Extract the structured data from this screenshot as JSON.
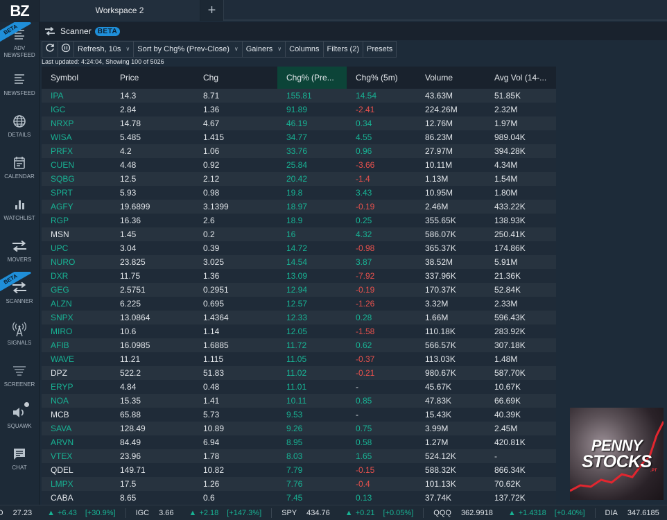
{
  "app": {
    "logo": "BZ",
    "tabs": [
      {
        "label": "Workspace 2"
      }
    ],
    "add_tab_label": "+"
  },
  "sidebar": {
    "items": [
      {
        "id": "adv-newsfeed",
        "label": "ADV NEWSFEED",
        "icon": "lines-icon",
        "beta": true
      },
      {
        "id": "newsfeed",
        "label": "NEWSFEED",
        "icon": "newsfeed-icon"
      },
      {
        "id": "details",
        "label": "DETAILS",
        "icon": "globe-icon"
      },
      {
        "id": "calendar",
        "label": "CALENDAR",
        "icon": "calendar-icon"
      },
      {
        "id": "watchlist",
        "label": "WATCHLIST",
        "icon": "bar-chart-icon"
      },
      {
        "id": "movers",
        "label": "MOVERS",
        "icon": "swap-icon"
      },
      {
        "id": "scanner",
        "label": "SCANNER",
        "icon": "swap-icon",
        "beta": true
      },
      {
        "id": "signals",
        "label": "SIGNALS",
        "icon": "antenna-icon"
      },
      {
        "id": "screener",
        "label": "SCREENER",
        "icon": "filter-icon"
      },
      {
        "id": "squawk",
        "label": "SQUAWK",
        "icon": "speaker-icon"
      },
      {
        "id": "chat",
        "label": "CHAT",
        "icon": "chat-icon"
      }
    ],
    "beta_label": "BETA"
  },
  "scanner": {
    "title": "Scanner",
    "badge": "BETA",
    "toolbar": {
      "refresh": "Refresh, 10s",
      "sort": "Sort by Chg% (Prev-Close)",
      "gainers": "Gainers",
      "columns": "Columns",
      "filters": "Filters (2)",
      "presets": "Presets"
    },
    "status": "Last updated: 4:24:04, Showing 100 of 5026",
    "columns": [
      "Symbol",
      "Price",
      "Chg",
      "Chg% (Pre...",
      "Chg% (5m)",
      "Volume",
      "Avg Vol (14-..."
    ],
    "sorted_column": 3,
    "rows": [
      {
        "symbol": "IPA",
        "price": "14.3",
        "chg": "8.71",
        "chgpct": "155.81",
        "chg5m": "14.54",
        "volume": "43.63M",
        "avgvol": "51.85K",
        "sym_color": "green",
        "dir5m": "pos"
      },
      {
        "symbol": "IGC",
        "price": "2.84",
        "chg": "1.36",
        "chgpct": "91.89",
        "chg5m": "-2.41",
        "volume": "224.26M",
        "avgvol": "2.32M",
        "sym_color": "green",
        "dir5m": "neg"
      },
      {
        "symbol": "NRXP",
        "price": "14.78",
        "chg": "4.67",
        "chgpct": "46.19",
        "chg5m": "0.34",
        "volume": "12.76M",
        "avgvol": "1.97M",
        "sym_color": "green",
        "dir5m": "pos"
      },
      {
        "symbol": "WISA",
        "price": "5.485",
        "chg": "1.415",
        "chgpct": "34.77",
        "chg5m": "4.55",
        "volume": "86.23M",
        "avgvol": "989.04K",
        "sym_color": "green",
        "dir5m": "pos"
      },
      {
        "symbol": "PRFX",
        "price": "4.2",
        "chg": "1.06",
        "chgpct": "33.76",
        "chg5m": "0.96",
        "volume": "27.97M",
        "avgvol": "394.28K",
        "sym_color": "green",
        "dir5m": "pos"
      },
      {
        "symbol": "CUEN",
        "price": "4.48",
        "chg": "0.92",
        "chgpct": "25.84",
        "chg5m": "-3.66",
        "volume": "10.11M",
        "avgvol": "4.34M",
        "sym_color": "green",
        "dir5m": "neg"
      },
      {
        "symbol": "SQBG",
        "price": "12.5",
        "chg": "2.12",
        "chgpct": "20.42",
        "chg5m": "-1.4",
        "volume": "1.13M",
        "avgvol": "1.54M",
        "sym_color": "green",
        "dir5m": "neg"
      },
      {
        "symbol": "SPRT",
        "price": "5.93",
        "chg": "0.98",
        "chgpct": "19.8",
        "chg5m": "3.43",
        "volume": "10.95M",
        "avgvol": "1.80M",
        "sym_color": "green",
        "dir5m": "pos"
      },
      {
        "symbol": "AGFY",
        "price": "19.6899",
        "chg": "3.1399",
        "chgpct": "18.97",
        "chg5m": "-0.19",
        "volume": "2.46M",
        "avgvol": "433.22K",
        "sym_color": "green",
        "dir5m": "neg"
      },
      {
        "symbol": "RGP",
        "price": "16.36",
        "chg": "2.6",
        "chgpct": "18.9",
        "chg5m": "0.25",
        "volume": "355.65K",
        "avgvol": "138.93K",
        "sym_color": "green",
        "dir5m": "pos"
      },
      {
        "symbol": "MSN",
        "price": "1.45",
        "chg": "0.2",
        "chgpct": "16",
        "chg5m": "4.32",
        "volume": "586.07K",
        "avgvol": "250.41K",
        "sym_color": "white",
        "dir5m": "pos"
      },
      {
        "symbol": "UPC",
        "price": "3.04",
        "chg": "0.39",
        "chgpct": "14.72",
        "chg5m": "-0.98",
        "volume": "365.37K",
        "avgvol": "174.86K",
        "sym_color": "green",
        "dir5m": "neg"
      },
      {
        "symbol": "NURO",
        "price": "23.825",
        "chg": "3.025",
        "chgpct": "14.54",
        "chg5m": "3.87",
        "volume": "38.52M",
        "avgvol": "5.91M",
        "sym_color": "green",
        "dir5m": "pos"
      },
      {
        "symbol": "DXR",
        "price": "11.75",
        "chg": "1.36",
        "chgpct": "13.09",
        "chg5m": "-7.92",
        "volume": "337.96K",
        "avgvol": "21.36K",
        "sym_color": "green",
        "dir5m": "neg"
      },
      {
        "symbol": "GEG",
        "price": "2.5751",
        "chg": "0.2951",
        "chgpct": "12.94",
        "chg5m": "-0.19",
        "volume": "170.37K",
        "avgvol": "52.84K",
        "sym_color": "green",
        "dir5m": "neg"
      },
      {
        "symbol": "ALZN",
        "price": "6.225",
        "chg": "0.695",
        "chgpct": "12.57",
        "chg5m": "-1.26",
        "volume": "3.32M",
        "avgvol": "2.33M",
        "sym_color": "green",
        "dir5m": "neg"
      },
      {
        "symbol": "SNPX",
        "price": "13.0864",
        "chg": "1.4364",
        "chgpct": "12.33",
        "chg5m": "0.28",
        "volume": "1.66M",
        "avgvol": "596.43K",
        "sym_color": "green",
        "dir5m": "pos"
      },
      {
        "symbol": "MIRO",
        "price": "10.6",
        "chg": "1.14",
        "chgpct": "12.05",
        "chg5m": "-1.58",
        "volume": "110.18K",
        "avgvol": "283.92K",
        "sym_color": "green",
        "dir5m": "neg"
      },
      {
        "symbol": "AFIB",
        "price": "16.0985",
        "chg": "1.6885",
        "chgpct": "11.72",
        "chg5m": "0.62",
        "volume": "566.57K",
        "avgvol": "307.18K",
        "sym_color": "green",
        "dir5m": "pos"
      },
      {
        "symbol": "WAVE",
        "price": "11.21",
        "chg": "1.115",
        "chgpct": "11.05",
        "chg5m": "-0.37",
        "volume": "113.03K",
        "avgvol": "1.48M",
        "sym_color": "green",
        "dir5m": "neg"
      },
      {
        "symbol": "DPZ",
        "price": "522.2",
        "chg": "51.83",
        "chgpct": "11.02",
        "chg5m": "-0.21",
        "volume": "980.67K",
        "avgvol": "587.70K",
        "sym_color": "white",
        "dir5m": "neg"
      },
      {
        "symbol": "ERYP",
        "price": "4.84",
        "chg": "0.48",
        "chgpct": "11.01",
        "chg5m": "-",
        "volume": "45.67K",
        "avgvol": "10.67K",
        "sym_color": "green",
        "dir5m": "neu"
      },
      {
        "symbol": "NOA",
        "price": "15.35",
        "chg": "1.41",
        "chgpct": "10.11",
        "chg5m": "0.85",
        "volume": "47.83K",
        "avgvol": "66.69K",
        "sym_color": "green",
        "dir5m": "pos"
      },
      {
        "symbol": "MCB",
        "price": "65.88",
        "chg": "5.73",
        "chgpct": "9.53",
        "chg5m": "-",
        "volume": "15.43K",
        "avgvol": "40.39K",
        "sym_color": "white",
        "dir5m": "neu"
      },
      {
        "symbol": "SAVA",
        "price": "128.49",
        "chg": "10.89",
        "chgpct": "9.26",
        "chg5m": "0.75",
        "volume": "3.99M",
        "avgvol": "2.45M",
        "sym_color": "green",
        "dir5m": "pos"
      },
      {
        "symbol": "ARVN",
        "price": "84.49",
        "chg": "6.94",
        "chgpct": "8.95",
        "chg5m": "0.58",
        "volume": "1.27M",
        "avgvol": "420.81K",
        "sym_color": "green",
        "dir5m": "pos"
      },
      {
        "symbol": "VTEX",
        "price": "23.96",
        "chg": "1.78",
        "chgpct": "8.03",
        "chg5m": "1.65",
        "volume": "524.12K",
        "avgvol": "-",
        "sym_color": "green",
        "dir5m": "pos"
      },
      {
        "symbol": "QDEL",
        "price": "149.71",
        "chg": "10.82",
        "chgpct": "7.79",
        "chg5m": "-0.15",
        "volume": "588.32K",
        "avgvol": "866.34K",
        "sym_color": "white",
        "dir5m": "neg"
      },
      {
        "symbol": "LMPX",
        "price": "17.5",
        "chg": "1.26",
        "chgpct": "7.76",
        "chg5m": "-0.4",
        "volume": "101.13K",
        "avgvol": "70.62K",
        "sym_color": "green",
        "dir5m": "neg"
      },
      {
        "symbol": "CABA",
        "price": "8.65",
        "chg": "0.6",
        "chgpct": "7.45",
        "chg5m": "0.13",
        "volume": "37.74K",
        "avgvol": "137.72K",
        "sym_color": "white",
        "dir5m": "pos"
      }
    ]
  },
  "ad": {
    "line1": "PENNY",
    "line2": "STOCKS",
    "suffix": ".PT"
  },
  "ticker": [
    {
      "symbol": "O",
      "price": "27.23",
      "change": "+6.43",
      "pct": "[+30.9%]",
      "dir": "up"
    },
    {
      "symbol": "IGC",
      "price": "3.66",
      "change": "+2.18",
      "pct": "[+147.3%]",
      "dir": "up"
    },
    {
      "symbol": "SPY",
      "price": "434.76",
      "change": "+0.21",
      "pct": "[+0.05%]",
      "dir": "up"
    },
    {
      "symbol": "QQQ",
      "price": "362.9918",
      "change": "+1.4318",
      "pct": "[+0.40%]",
      "dir": "up"
    },
    {
      "symbol": "DIA",
      "price": "347.6185",
      "change": "",
      "pct": "",
      "dir": "down"
    }
  ],
  "colors": {
    "positive": "#18b394",
    "negative": "#e8514d",
    "accent": "#1f8fd9",
    "sorted_header": "#0c4438"
  }
}
